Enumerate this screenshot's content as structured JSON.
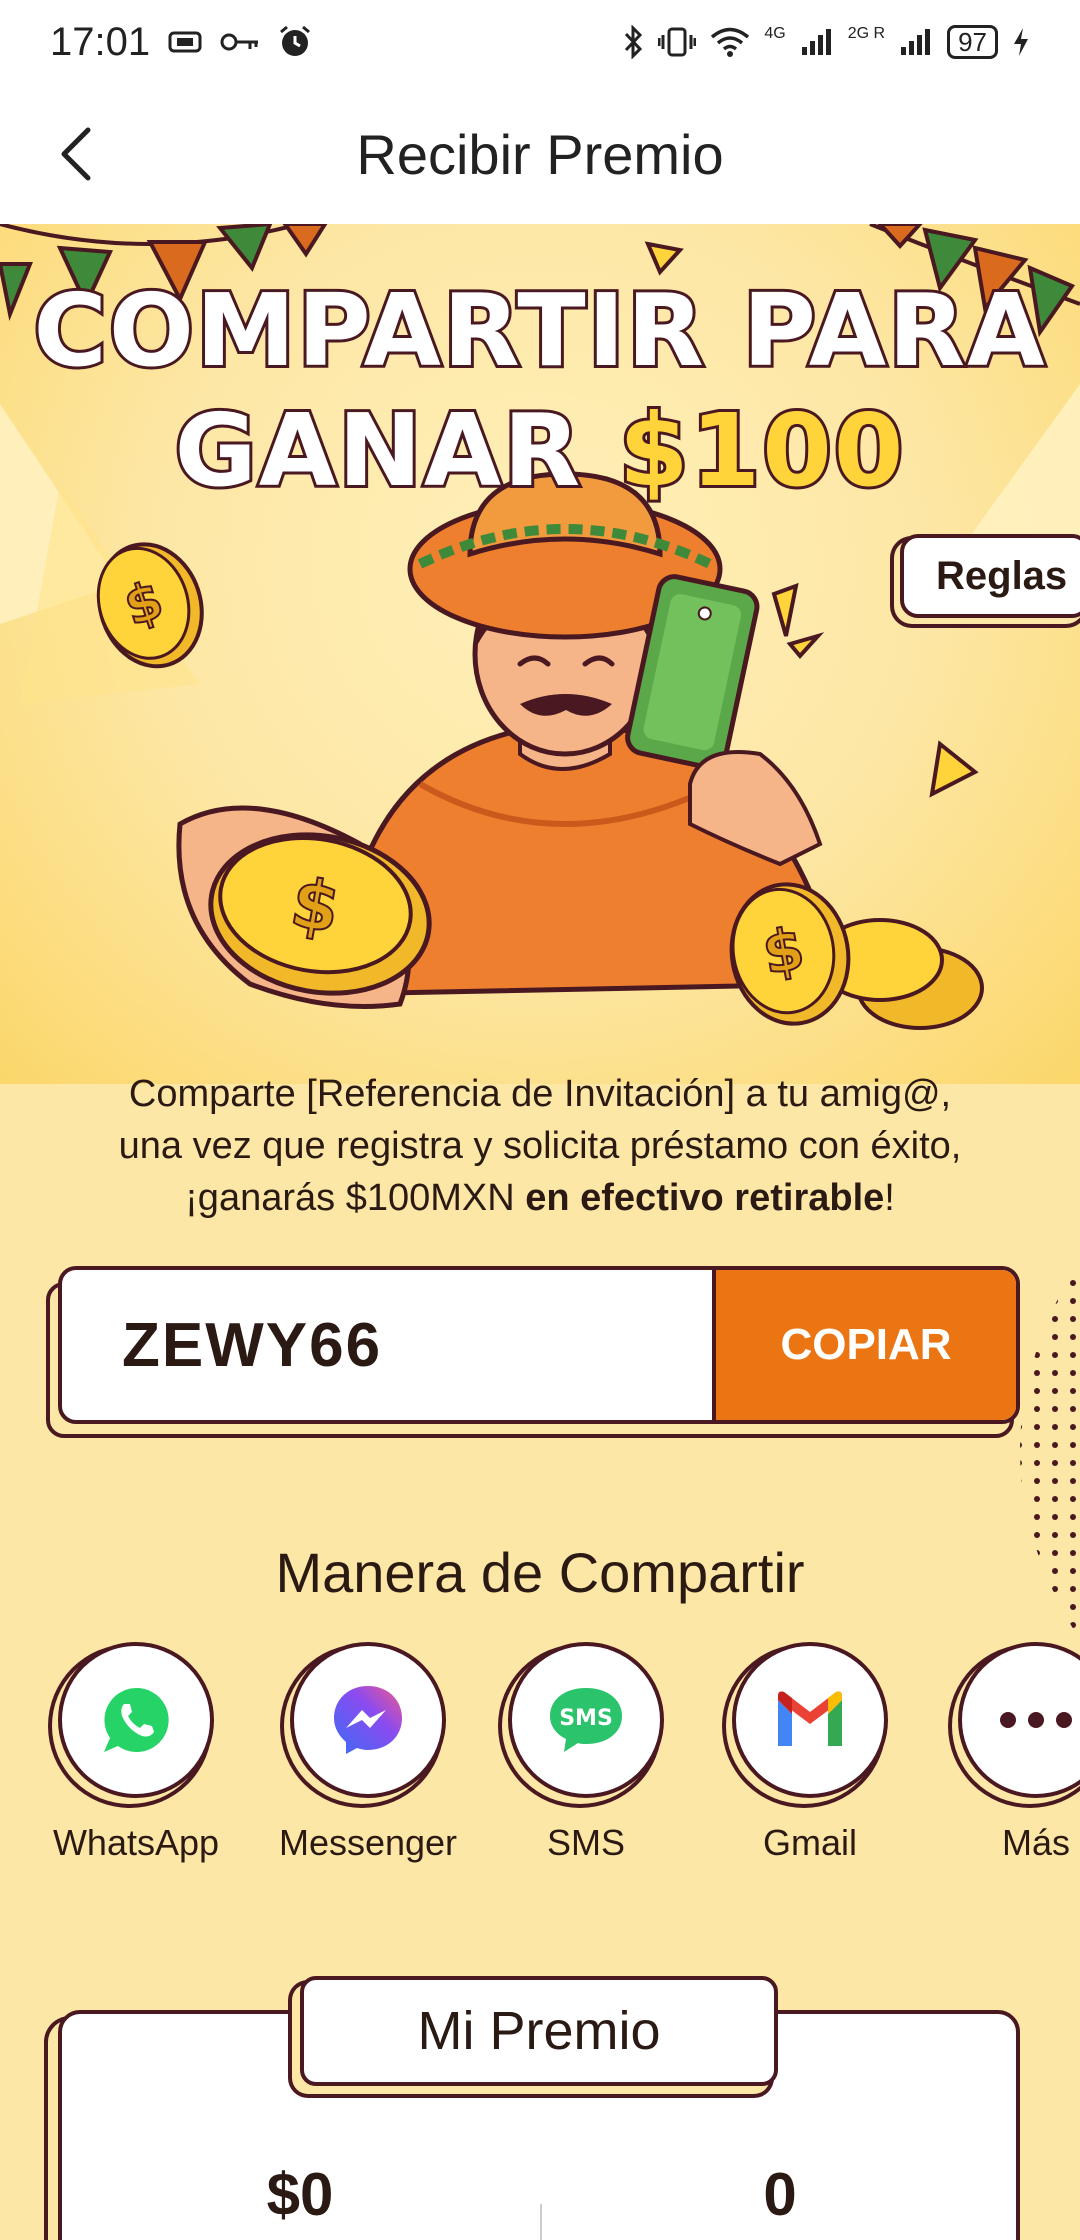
{
  "status_bar": {
    "time": "17:01",
    "battery": "97",
    "network_1": "4G",
    "network_2": "2G R"
  },
  "header": {
    "title": "Recibir Premio"
  },
  "hero": {
    "title_line1": "COMPARTIR PARA",
    "title_line2_prefix": "GANAR",
    "title_line2_amount": "$100",
    "rules_label": "Reglas"
  },
  "description": {
    "line1": "Comparte [Referencia de Invitación] a tu amig@,",
    "line2": "una vez que registra y solicita préstamo con éxito,",
    "line3_prefix": "¡ganarás $100MXN",
    "line3_bold": "en efectivo retirable",
    "line3_suffix": "!"
  },
  "referral": {
    "code": "ZEWY66",
    "copy_label": "COPIAR"
  },
  "share": {
    "title": "Manera de Compartir",
    "options": [
      {
        "label": "WhatsApp",
        "icon": "whatsapp-icon",
        "color": "#25D366"
      },
      {
        "label": "Messenger",
        "icon": "messenger-icon",
        "color": "#7B5CF0"
      },
      {
        "label": "SMS",
        "icon": "sms-icon",
        "color": "#2BC36B"
      },
      {
        "label": "Gmail",
        "icon": "gmail-icon",
        "color": "#EA4335"
      },
      {
        "label": "Más",
        "icon": "more-icon",
        "color": "#4a1820"
      }
    ]
  },
  "prize": {
    "title": "Mi Premio",
    "amount": "$0",
    "count": "0"
  },
  "colors": {
    "background": "#FDE7A6",
    "accent": "#EB7512",
    "outline": "#4a1820",
    "gold": "#FFD33A"
  }
}
